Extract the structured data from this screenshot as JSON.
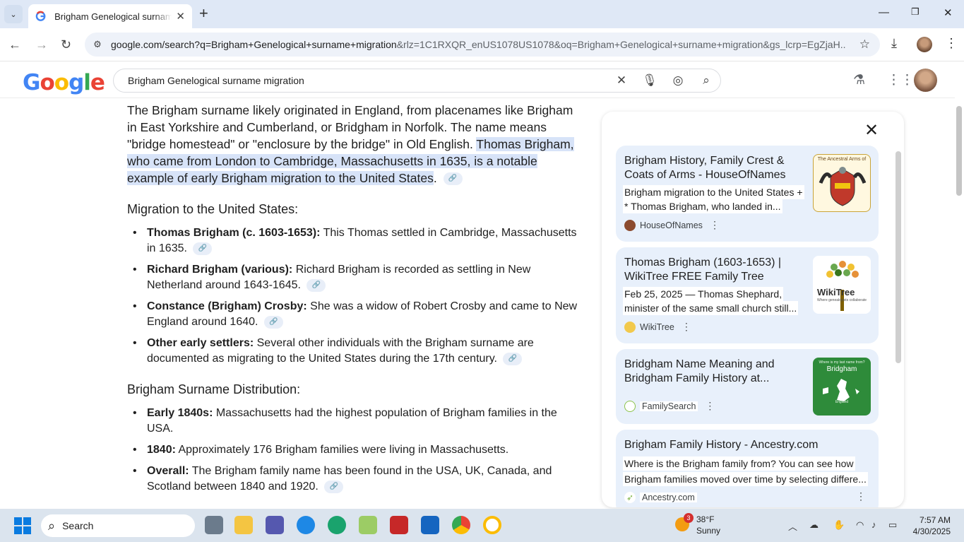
{
  "browser": {
    "tab_title": "Brigham Genelogical surname migration - Google Search",
    "tab_close": "✕",
    "new_tab": "+",
    "url_main": "google.com/search?q=Brigham+Genelogical+surname+migration",
    "url_rest": "&rlz=1C1RXQR_enUS1078US1078&oq=Brigham+Genelogical+surname+migration&gs_lcrp=EgZjaH..."
  },
  "search": {
    "query": "Brigham Genelogical surname migration"
  },
  "answer": {
    "intro_plain": "The Brigham surname likely originated in England, from placenames like Brigham in East Yorkshire and Cumberland, or Bridgham in Norfolk. The name means \"bridge homestead\" or \"enclosure by the bridge\" in Old English. ",
    "intro_highlight": "Thomas Brigham, who came from London to Cambridge, Massachusetts in 1635, is a notable example of early Brigham migration to the United States",
    "intro_end": ".",
    "migration_heading": "Migration to the United States:",
    "migration_items": [
      {
        "bold": "Thomas Brigham (c. 1603-1653):",
        "text": " This Thomas settled in Cambridge, Massachusetts in 1635."
      },
      {
        "bold": "Richard Brigham (various):",
        "text": " Richard Brigham is recorded as settling in New Netherland around 1643-1645."
      },
      {
        "bold": "Constance (Brigham) Crosby:",
        "text": " She was a widow of Robert Crosby and came to New England around 1640."
      },
      {
        "bold": "Other early settlers:",
        "text": " Several other individuals with the Brigham surname are documented as migrating to the United States during the 17th century."
      }
    ],
    "distribution_heading": "Brigham Surname Distribution:",
    "distribution_items": [
      {
        "bold": "Early 1840s:",
        "text": " Massachusetts had the highest population of Brigham families in the USA."
      },
      {
        "bold": "1840:",
        "text": " Approximately 176 Brigham families were living in Massachusetts."
      },
      {
        "bold": "Overall:",
        "text": " The Brigham family name has been found in the USA, UK, Canada, and Scotland between 1840 and 1920."
      }
    ]
  },
  "sources": [
    {
      "title": "Brigham History, Family Crest & Coats of Arms - HouseOfNames",
      "snippet1": "Brigham migration to the United States +",
      "snippet2": "* Thomas Brigham, who landed in...",
      "source": "HouseOfNames",
      "thumb_label": "The Ancestral Arms of"
    },
    {
      "title": "Thomas Brigham (1603-1653) | WikiTree FREE Family Tree",
      "snippet1": "Feb 25, 2025 — Thomas Shephard,",
      "snippet2": "minister of the same small church still...",
      "source": "WikiTree",
      "thumb_label": "WikiTree",
      "thumb_sub": "Where genealogists collaborate"
    },
    {
      "title": "Bridgham Name Meaning and Bridgham Family History at...",
      "source": "FamilySearch",
      "thumb_label": "Bridgham",
      "thumb_top": "Where is my last name from?",
      "thumb_bottom": "England"
    },
    {
      "title": "Brigham Family History - Ancestry.com",
      "snippet1": "Where is the Brigham family from? You can see how",
      "snippet2": "Brigham families moved over time by selecting differe...",
      "source": "Ancestry.com"
    }
  ],
  "taskbar": {
    "search_label": "Search",
    "weather_temp": "38°F",
    "weather_cond": "Sunny",
    "weather_badge": "3",
    "time": "7:57 AM",
    "date": "4/30/2025"
  }
}
